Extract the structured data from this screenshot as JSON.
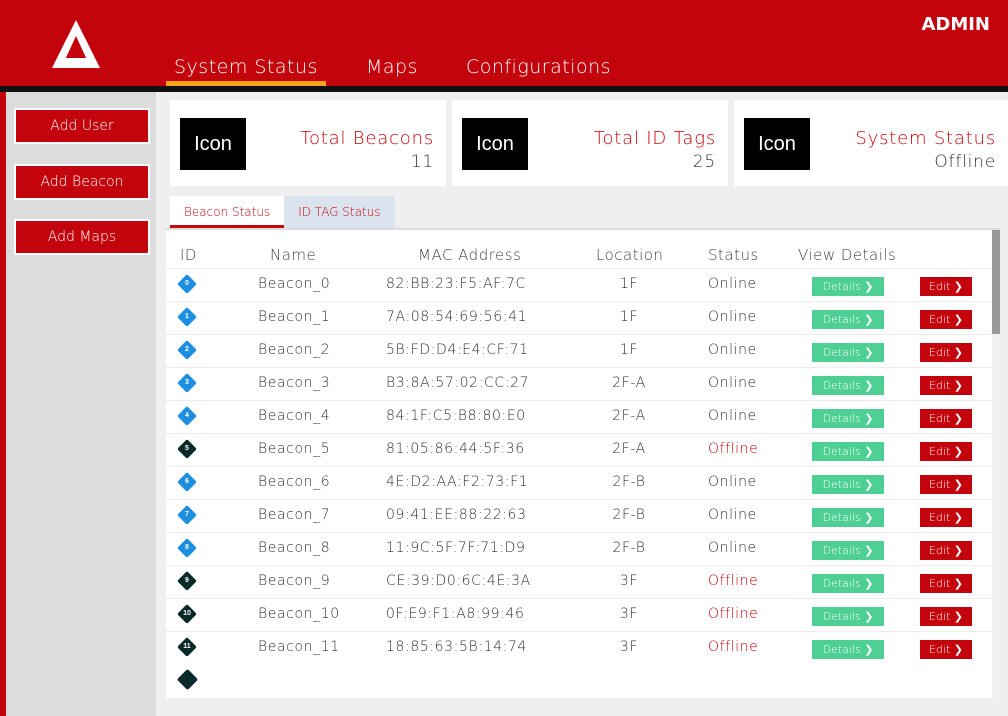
{
  "header": {
    "admin_label": "ADMIN",
    "nav": [
      "System Status",
      "Maps",
      "Configurations"
    ],
    "brand_color": "#c4040c",
    "active_underline_color": "#f5a41a"
  },
  "sidebar": {
    "buttons": [
      "Add User",
      "Add Beacon",
      "Add Maps"
    ]
  },
  "cards": [
    {
      "icon": "Icon",
      "title": "Total Beacons",
      "value": "11"
    },
    {
      "icon": "Icon",
      "title": "Total ID Tags",
      "value": "25"
    },
    {
      "icon": "Icon",
      "title": "System Status",
      "value": "Offline"
    }
  ],
  "subtabs": [
    "Beacon Status",
    "ID TAG Status"
  ],
  "table": {
    "headers": [
      "ID",
      "Name",
      "MAC Address",
      "Location",
      "Status",
      "View Details"
    ],
    "details_label": "Details ❯",
    "edit_label": "Edit ❯",
    "rows": [
      {
        "id": "0",
        "name": "Beacon_0",
        "mac": "82:BB:23:F5:AF:7C",
        "location": "1F",
        "status": "Online"
      },
      {
        "id": "1",
        "name": "Beacon_1",
        "mac": "7A:08:54:69:56:41",
        "location": "1F",
        "status": "Online"
      },
      {
        "id": "2",
        "name": "Beacon_2",
        "mac": "5B:FD:D4:E4:CF:71",
        "location": "1F",
        "status": "Online"
      },
      {
        "id": "3",
        "name": "Beacon_3",
        "mac": "B3:8A:57:02:CC:27",
        "location": "2F-A",
        "status": "Online"
      },
      {
        "id": "4",
        "name": "Beacon_4",
        "mac": "84:1F:C5:B8:80:E0",
        "location": "2F-A",
        "status": "Online"
      },
      {
        "id": "5",
        "name": "Beacon_5",
        "mac": "81:05:86:44:5F:36",
        "location": "2F-A",
        "status": "Offline"
      },
      {
        "id": "6",
        "name": "Beacon_6",
        "mac": "4E:D2:AA:F2:73:F1",
        "location": "2F-B",
        "status": "Online"
      },
      {
        "id": "7",
        "name": "Beacon_7",
        "mac": "09:41:EE:88:22:63",
        "location": "2F-B",
        "status": "Online"
      },
      {
        "id": "8",
        "name": "Beacon_8",
        "mac": "11:9C:5F:7F:71:D9",
        "location": "2F-B",
        "status": "Online"
      },
      {
        "id": "9",
        "name": "Beacon_9",
        "mac": "CE:39:D0:6C:4E:3A",
        "location": "3F",
        "status": "Offline"
      },
      {
        "id": "10",
        "name": "Beacon_10",
        "mac": "0F:E9:F1:A8:99:46",
        "location": "3F",
        "status": "Offline"
      },
      {
        "id": "11",
        "name": "Beacon_11",
        "mac": "18:85:63:5B:14:74",
        "location": "3F",
        "status": "Offline"
      }
    ],
    "online_diamond_color": "#1e8ee0",
    "offline_diamond_color": "#0a2a2a",
    "details_button_color": "#4ecf93"
  }
}
